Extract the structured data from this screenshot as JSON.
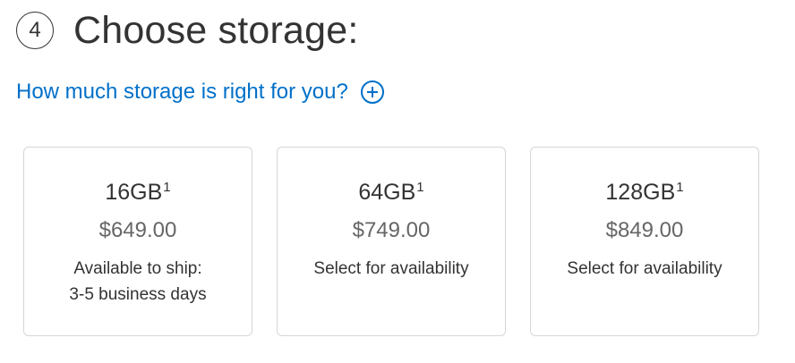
{
  "step": {
    "number": "4",
    "title": "Choose storage:"
  },
  "help": {
    "link_text": "How much storage is right for you?",
    "icon": "plus-circle-icon",
    "color": "#0070c9"
  },
  "options": [
    {
      "capacity": "16GB",
      "footnote": "1",
      "price": "$649.00",
      "availability_line1": "Available to ship:",
      "availability_line2": "3-5 business days"
    },
    {
      "capacity": "64GB",
      "footnote": "1",
      "price": "$749.00",
      "availability_line1": "Select for availability",
      "availability_line2": ""
    },
    {
      "capacity": "128GB",
      "footnote": "1",
      "price": "$849.00",
      "availability_line1": "Select for availability",
      "availability_line2": ""
    }
  ]
}
